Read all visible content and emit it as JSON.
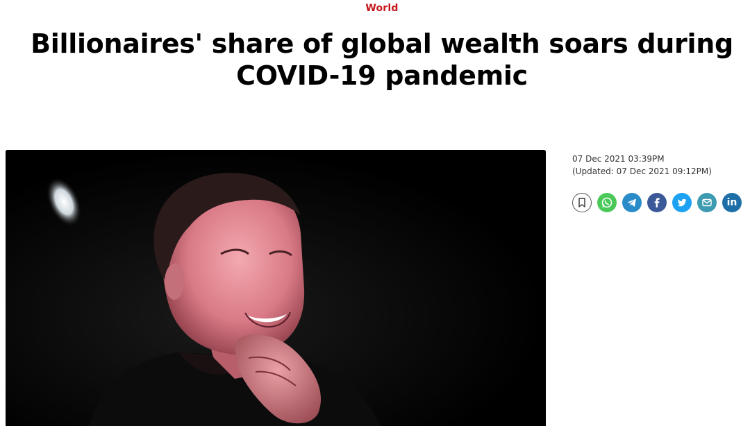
{
  "section": "World",
  "headline": "Billionaires' share of global wealth soars during COVID-19 pandemic",
  "hero_image": {
    "type": "photo"
  },
  "meta": {
    "published": "07 Dec 2021 03:39PM",
    "updated": "(Updated: 07 Dec 2021 09:12PM)"
  },
  "share_buttons": [
    {
      "name": "bookmark-icon",
      "color": "#ffffff"
    },
    {
      "name": "whatsapp-icon",
      "color": "#4ac959"
    },
    {
      "name": "telegram-icon",
      "color": "#2a8bc9"
    },
    {
      "name": "facebook-icon",
      "color": "#3b5998"
    },
    {
      "name": "twitter-icon",
      "color": "#1da1f2"
    },
    {
      "name": "email-icon",
      "color": "#3d9bb1"
    },
    {
      "name": "linkedin-icon",
      "color": "#1e6fa8",
      "glyph": "in"
    }
  ],
  "colors": {
    "accent": "#c4161c",
    "text": "#000000"
  }
}
